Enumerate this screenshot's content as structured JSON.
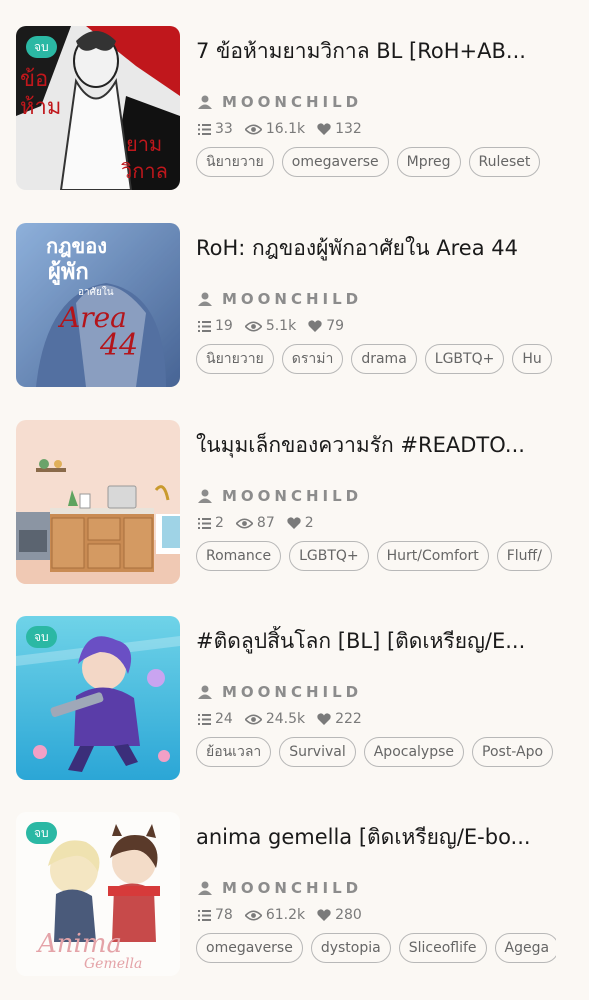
{
  "stories": [
    {
      "badge": "จบ",
      "title": "7 ข้อห้ามยามวิกาล BL [RoH+AB...",
      "author": "MOONCHILD",
      "chapters": "33",
      "views": "16.1k",
      "likes": "132",
      "tags": [
        "นิยายวาย",
        "omegaverse",
        "Mpreg",
        "Ruleset"
      ],
      "cover_text": [
        "ข้อ",
        "ห้าม",
        "ยาม",
        "วิกาล"
      ]
    },
    {
      "badge": "",
      "title": "RoH: กฎของผู้พักอาศัยใน Area 44",
      "author": "MOONCHILD",
      "chapters": "19",
      "views": "5.1k",
      "likes": "79",
      "tags": [
        "นิยายวาย",
        "ดราม่า",
        "drama",
        "LGBTQ+",
        "Hu"
      ],
      "cover_text": [
        "กฎของ",
        "ผู้พัก",
        "อาศัยใน",
        "Area",
        "44"
      ]
    },
    {
      "badge": "",
      "title": "ในมุมเล็กของความรัก #READTO...",
      "author": "MOONCHILD",
      "chapters": "2",
      "views": "87",
      "likes": "2",
      "tags": [
        "Romance",
        "LGBTQ+",
        "Hurt/Comfort",
        "Fluff/"
      ],
      "cover_text": []
    },
    {
      "badge": "จบ",
      "title": "#ติดลูปสิ้นโลก [BL] [ติดเหรียญ/E...",
      "author": "MOONCHILD",
      "chapters": "24",
      "views": "24.5k",
      "likes": "222",
      "tags": [
        "ย้อนเวลา",
        "Survival",
        "Apocalypse",
        "Post-Apo"
      ],
      "cover_text": []
    },
    {
      "badge": "จบ",
      "title": "anima gemella [ติดเหรียญ/E-bo...",
      "author": "MOONCHILD",
      "chapters": "78",
      "views": "61.2k",
      "likes": "280",
      "tags": [
        "omegaverse",
        "dystopia",
        "Sliceoflife",
        "Agega"
      ],
      "cover_text": [
        "Anima",
        "Gemella"
      ]
    }
  ],
  "icons": {
    "author": "person-icon",
    "chapters": "list-icon",
    "views": "eye-icon",
    "likes": "heart-icon"
  },
  "colors": {
    "background": "#fbf8f4",
    "badge": "#2bb8a4",
    "muted_text": "#8c8c8c"
  }
}
